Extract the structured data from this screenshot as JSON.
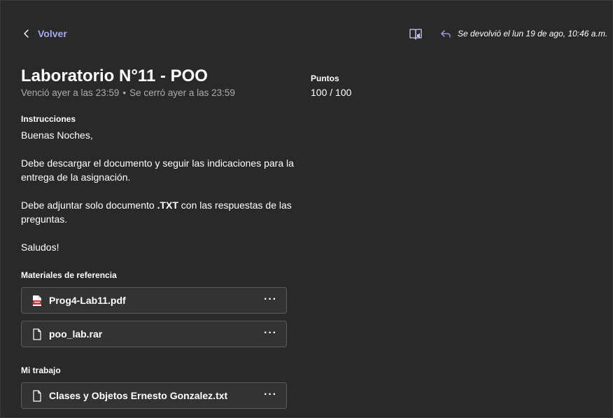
{
  "header": {
    "back_label": "Volver",
    "returned_text": "Se devolvió el lun 19 de ago, 10:46 a.m."
  },
  "assignment": {
    "title": "Laboratorio N°11 - POO",
    "due": "Venció ayer a las 23:59",
    "separator": "•",
    "closed": "Se cerró ayer a las 23:59"
  },
  "points": {
    "label": "Puntos",
    "value": "100 / 100"
  },
  "instructions": {
    "label": "Instrucciones",
    "greeting": "Buenas Noches,",
    "line1": "Debe descargar el documento y seguir las indicaciones para la entrega de la asignación.",
    "line2_pre": "Debe adjuntar solo documento ",
    "line2_bold": ".TXT",
    "line2_post": " con las respuestas de las preguntas.",
    "closing": "Saludos!"
  },
  "reference_materials": {
    "label": "Materiales de referencia",
    "files": [
      {
        "name": "Prog4-Lab11.pdf",
        "icon": "pdf-file-icon"
      },
      {
        "name": "poo_lab.rar",
        "icon": "document-icon"
      }
    ]
  },
  "my_work": {
    "label": "Mi trabajo",
    "files": [
      {
        "name": "Clases y Objetos Ernesto Gonzalez.txt",
        "icon": "document-icon"
      }
    ]
  },
  "more_glyph": "···",
  "colors": {
    "background": "#292929",
    "accent": "#a6a8f0",
    "muted": "#adadad",
    "card_bg": "#333333",
    "card_border": "#5c5c5c",
    "pdf_red": "#d13438"
  }
}
